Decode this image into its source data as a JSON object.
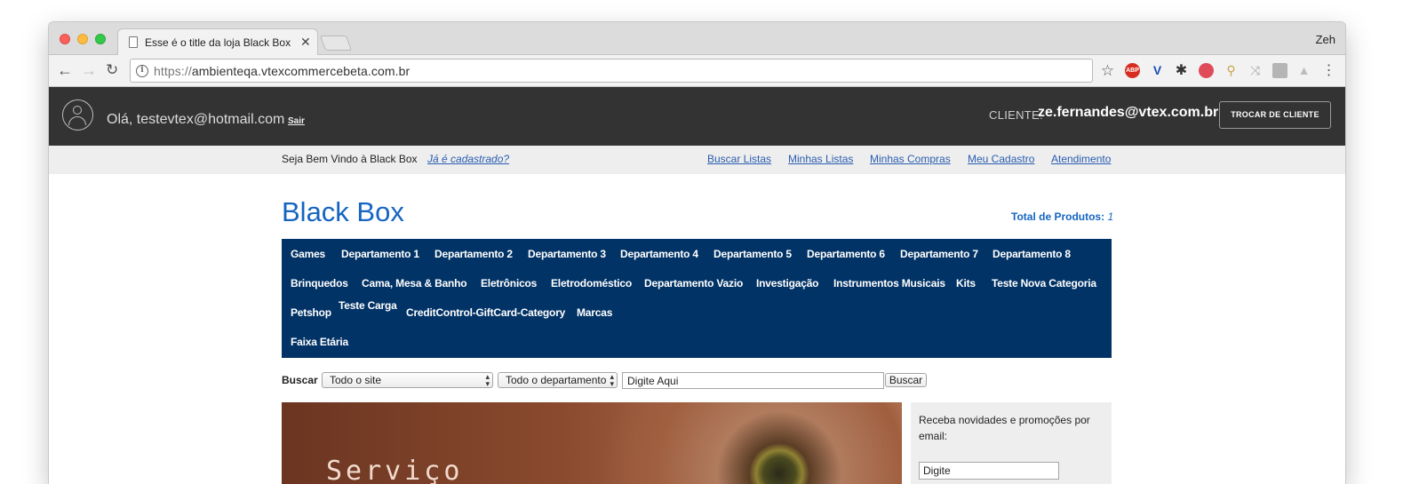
{
  "browser": {
    "tab_title": "Esse é o title da loja Black Box",
    "profile_name": "Zeh",
    "url_protocol": "https://",
    "url_host": "ambienteqa.vtexcommercebeta.com.br"
  },
  "extensions": [
    "star-icon",
    "adblock-plus-icon",
    "vtex-icon",
    "gear-icon",
    "notification-icon",
    "tag-icon",
    "shuffle-icon",
    "gif-icon",
    "drive-icon",
    "menu-icon"
  ],
  "extension_colors": {
    "abp": "#d62d20",
    "vtex": "#1a4fb3"
  },
  "site_header": {
    "greeting": "Olá, testevtex@hotmail.com",
    "logout_label": "Sair",
    "client_label": "CLIENTE:",
    "client_email": "ze.fernandes@vtex.com.br",
    "switch_client_label": "TROCAR DE CLIENTE"
  },
  "links_bar": {
    "welcome": "Seja Bem Vindo à Black Box",
    "registered_link": "Já é cadastrado?",
    "links": [
      "Buscar Listas",
      "Minhas Listas",
      "Minhas Compras",
      "Meu Cadastro",
      "Atendimento"
    ]
  },
  "store": {
    "name": "Black Box",
    "total_label": "Total de Produtos:",
    "total_value": "1",
    "brand_color": "#1565c0",
    "nav_color": "#023366"
  },
  "categories": {
    "row1": [
      "Games",
      "Departamento 1",
      "Departamento 2",
      "Departamento 3",
      "Departamento 4",
      "Departamento 5",
      "Departamento 6",
      "Departamento 7",
      "Departamento 8"
    ],
    "row2": [
      "Brinquedos",
      "Cama, Mesa & Banho",
      "Eletrônicos",
      "Eletrodoméstico",
      "Departamento Vazio",
      "Investigação",
      "Instrumentos Musicais",
      "Kits",
      "Teste Nova Categoria"
    ],
    "row3": [
      "Petshop",
      "Teste Carga",
      "CreditControl-GiftCard-Category",
      "Marcas"
    ],
    "row4": [
      "Faixa Etária"
    ]
  },
  "search": {
    "label": "Buscar",
    "scope_value": "Todo o site",
    "department_value": "Todo o departamento",
    "query_value": "Digite Aqui",
    "button_label": "Buscar"
  },
  "banner": {
    "text": "Serviço"
  },
  "newsletter": {
    "text": "Receba novidades e promoções por email:",
    "input_value": "Digite"
  }
}
